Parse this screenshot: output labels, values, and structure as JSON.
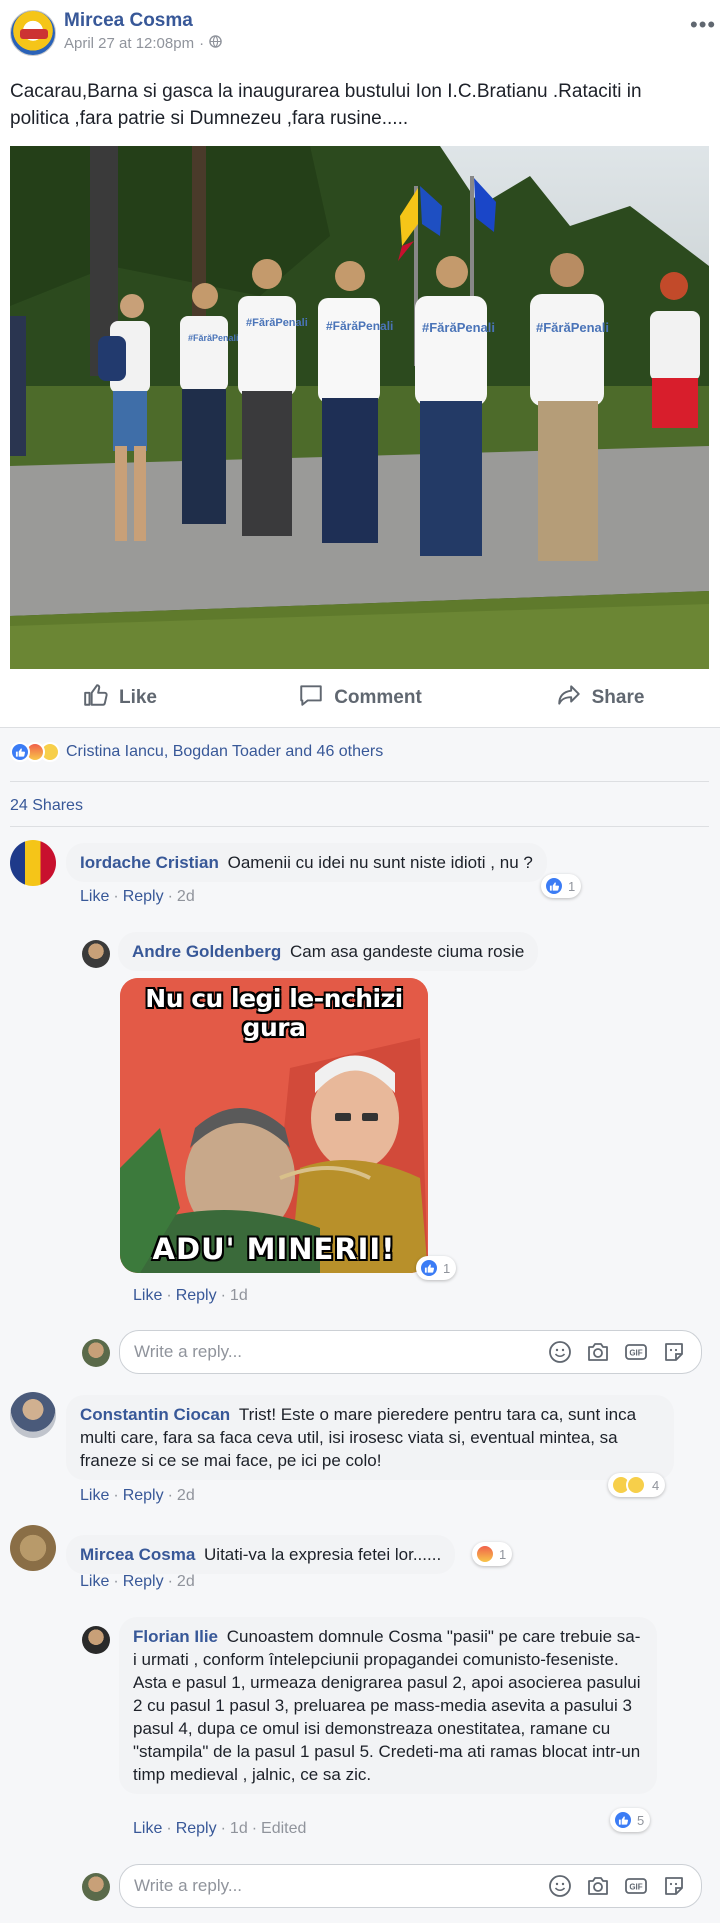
{
  "post": {
    "author": "Mircea Cosma",
    "time": "April 27 at 12:08pm",
    "text": "Cacarau,Barna si gasca la inaugurarea bustului Ion I.C.Bratianu .Rataciti in politica ,fara patrie si Dumnezeu ,fara rusine.....",
    "shirt_text": "#FărăPenali",
    "icons": {
      "more": "more-options-icon",
      "audience": "public-globe-icon"
    }
  },
  "actions": {
    "like": "Like",
    "comment": "Comment",
    "share": "Share"
  },
  "reactions_summary": {
    "text": "Cristina Iancu, Bogdan Toader and 46 others"
  },
  "shares": "24 Shares",
  "comments": [
    {
      "author": "Iordache Cristian",
      "text": "Oamenii cu idei nu sunt niste idioti , nu ?",
      "like": "Like",
      "reply": "Reply",
      "time": "2d",
      "reaction_count": "1",
      "replies": [
        {
          "author": "Andre Goldenberg",
          "text": "Cam asa gandeste ciuma rosie",
          "meme_top": "Nu cu legi le-nchizi gura",
          "meme_bottom": "ADU' MINERII!",
          "like": "Like",
          "reply": "Reply",
          "time": "1d",
          "reaction_count": "1"
        }
      ]
    },
    {
      "author": "Constantin Ciocan",
      "text": "Trist! Este o mare pieredere pentru tara ca, sunt inca multi care, fara sa faca ceva util, isi irosesc viata si, eventual mintea, sa franeze si ce se mai face, pe ici pe colo!",
      "like": "Like",
      "reply": "Reply",
      "time": "2d",
      "reaction_count": "4"
    },
    {
      "author": "Mircea Cosma",
      "text": "Uitati-va la expresia fetei lor......",
      "like": "Like",
      "reply": "Reply",
      "time": "2d",
      "reaction_count": "1",
      "replies": [
        {
          "author": "Florian Ilie",
          "text": "Cunoastem domnule Cosma \"pasii\" pe care trebuie sa-i urmati , conform întelepciunii propagandei comunisto-feseniste. Asta e pasul 1, urmeaza denigrarea pasul 2, apoi asocierea pasului 2 cu pasul 1 pasul 3, preluarea pe mass-media asevita a pasului 3 pasul 4, dupa ce omul isi demonstreaza onestitatea, ramane cu \"stampila\" de la pasul 1 pasul 5. Credeti-ma ati ramas blocat intr-un timp medieval , jalnic, ce sa zic.",
          "like": "Like",
          "reply": "Reply",
          "time": "1d",
          "edited": "Edited",
          "reaction_count": "5"
        }
      ]
    }
  ],
  "reply_box": {
    "placeholder": "Write a reply..."
  },
  "colors": {
    "link": "#385898",
    "muted": "#90949c",
    "bubble": "#f2f3f5",
    "like_blue": "#3b7cf5"
  }
}
